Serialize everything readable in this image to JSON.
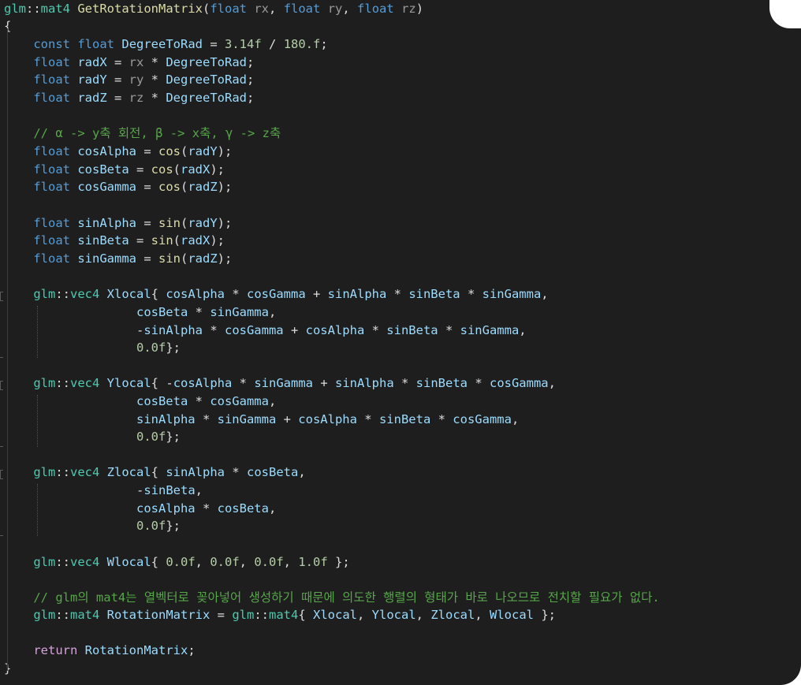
{
  "editor": {
    "language": "C++",
    "theme_colors": {
      "background": "#1e1e1e",
      "keyword": "#569cd6",
      "type_namespace": "#4ec9b0",
      "identifier": "#9cdcfe",
      "function": "#dcdcaa",
      "number": "#b5cea8",
      "comment": "#57a64a",
      "control_keyword": "#d8a0df"
    },
    "lines": [
      [
        [
          "glm",
          "ns"
        ],
        [
          "::",
          "punc"
        ],
        [
          "mat4",
          "ns"
        ],
        [
          " ",
          "punc"
        ],
        [
          "GetRotationMatrix",
          "fn"
        ],
        [
          "(",
          "punc"
        ],
        [
          "float",
          "kw"
        ],
        [
          " ",
          "punc"
        ],
        [
          "rx",
          "param"
        ],
        [
          ", ",
          "punc"
        ],
        [
          "float",
          "kw"
        ],
        [
          " ",
          "punc"
        ],
        [
          "ry",
          "param"
        ],
        [
          ", ",
          "punc"
        ],
        [
          "float",
          "kw"
        ],
        [
          " ",
          "punc"
        ],
        [
          "rz",
          "param"
        ],
        [
          ")",
          "punc"
        ]
      ],
      [
        [
          "{",
          "brace"
        ]
      ],
      [
        [
          "    ",
          "punc"
        ],
        [
          "const",
          "kw"
        ],
        [
          " ",
          "punc"
        ],
        [
          "float",
          "kw"
        ],
        [
          " ",
          "punc"
        ],
        [
          "DegreeToRad",
          "id"
        ],
        [
          " = ",
          "punc"
        ],
        [
          "3.14f",
          "num"
        ],
        [
          " / ",
          "punc"
        ],
        [
          "180.f",
          "num"
        ],
        [
          ";",
          "punc"
        ]
      ],
      [
        [
          "    ",
          "punc"
        ],
        [
          "float",
          "kw"
        ],
        [
          " ",
          "punc"
        ],
        [
          "radX",
          "id"
        ],
        [
          " = ",
          "punc"
        ],
        [
          "rx",
          "param"
        ],
        [
          " * ",
          "punc"
        ],
        [
          "DegreeToRad",
          "id"
        ],
        [
          ";",
          "punc"
        ]
      ],
      [
        [
          "    ",
          "punc"
        ],
        [
          "float",
          "kw"
        ],
        [
          " ",
          "punc"
        ],
        [
          "radY",
          "id"
        ],
        [
          " = ",
          "punc"
        ],
        [
          "ry",
          "param"
        ],
        [
          " * ",
          "punc"
        ],
        [
          "DegreeToRad",
          "id"
        ],
        [
          ";",
          "punc"
        ]
      ],
      [
        [
          "    ",
          "punc"
        ],
        [
          "float",
          "kw"
        ],
        [
          " ",
          "punc"
        ],
        [
          "radZ",
          "id"
        ],
        [
          " = ",
          "punc"
        ],
        [
          "rz",
          "param"
        ],
        [
          " * ",
          "punc"
        ],
        [
          "DegreeToRad",
          "id"
        ],
        [
          ";",
          "punc"
        ]
      ],
      [],
      [
        [
          "    ",
          "punc"
        ],
        [
          "// α -> y축 회전, β -> x축, γ -> z축",
          "cmt"
        ]
      ],
      [
        [
          "    ",
          "punc"
        ],
        [
          "float",
          "kw"
        ],
        [
          " ",
          "punc"
        ],
        [
          "cosAlpha",
          "id"
        ],
        [
          " = ",
          "punc"
        ],
        [
          "cos",
          "fn"
        ],
        [
          "(",
          "punc"
        ],
        [
          "radY",
          "id"
        ],
        [
          ");",
          "punc"
        ]
      ],
      [
        [
          "    ",
          "punc"
        ],
        [
          "float",
          "kw"
        ],
        [
          " ",
          "punc"
        ],
        [
          "cosBeta",
          "id"
        ],
        [
          " = ",
          "punc"
        ],
        [
          "cos",
          "fn"
        ],
        [
          "(",
          "punc"
        ],
        [
          "radX",
          "id"
        ],
        [
          ");",
          "punc"
        ]
      ],
      [
        [
          "    ",
          "punc"
        ],
        [
          "float",
          "kw"
        ],
        [
          " ",
          "punc"
        ],
        [
          "cosGamma",
          "id"
        ],
        [
          " = ",
          "punc"
        ],
        [
          "cos",
          "fn"
        ],
        [
          "(",
          "punc"
        ],
        [
          "radZ",
          "id"
        ],
        [
          ");",
          "punc"
        ]
      ],
      [],
      [
        [
          "    ",
          "punc"
        ],
        [
          "float",
          "kw"
        ],
        [
          " ",
          "punc"
        ],
        [
          "sinAlpha",
          "id"
        ],
        [
          " = ",
          "punc"
        ],
        [
          "sin",
          "fn"
        ],
        [
          "(",
          "punc"
        ],
        [
          "radY",
          "id"
        ],
        [
          ");",
          "punc"
        ]
      ],
      [
        [
          "    ",
          "punc"
        ],
        [
          "float",
          "kw"
        ],
        [
          " ",
          "punc"
        ],
        [
          "sinBeta",
          "id"
        ],
        [
          " = ",
          "punc"
        ],
        [
          "sin",
          "fn"
        ],
        [
          "(",
          "punc"
        ],
        [
          "radX",
          "id"
        ],
        [
          ");",
          "punc"
        ]
      ],
      [
        [
          "    ",
          "punc"
        ],
        [
          "float",
          "kw"
        ],
        [
          " ",
          "punc"
        ],
        [
          "sinGamma",
          "id"
        ],
        [
          " = ",
          "punc"
        ],
        [
          "sin",
          "fn"
        ],
        [
          "(",
          "punc"
        ],
        [
          "radZ",
          "id"
        ],
        [
          ");",
          "punc"
        ]
      ],
      [],
      [
        [
          "    ",
          "punc"
        ],
        [
          "glm",
          "ns"
        ],
        [
          "::",
          "punc"
        ],
        [
          "vec4",
          "ns"
        ],
        [
          " ",
          "punc"
        ],
        [
          "Xlocal",
          "id"
        ],
        [
          "{ ",
          "punc"
        ],
        [
          "cosAlpha",
          "id"
        ],
        [
          " * ",
          "punc"
        ],
        [
          "cosGamma",
          "id"
        ],
        [
          " + ",
          "punc"
        ],
        [
          "sinAlpha",
          "id"
        ],
        [
          " * ",
          "punc"
        ],
        [
          "sinBeta",
          "id"
        ],
        [
          " * ",
          "punc"
        ],
        [
          "sinGamma",
          "id"
        ],
        [
          ",",
          "punc"
        ]
      ],
      [
        [
          "                  ",
          "punc"
        ],
        [
          "cosBeta",
          "id"
        ],
        [
          " * ",
          "punc"
        ],
        [
          "sinGamma",
          "id"
        ],
        [
          ",",
          "punc"
        ]
      ],
      [
        [
          "                  ",
          "punc"
        ],
        [
          "-",
          "punc"
        ],
        [
          "sinAlpha",
          "id"
        ],
        [
          " * ",
          "punc"
        ],
        [
          "cosGamma",
          "id"
        ],
        [
          " + ",
          "punc"
        ],
        [
          "cosAlpha",
          "id"
        ],
        [
          " * ",
          "punc"
        ],
        [
          "sinBeta",
          "id"
        ],
        [
          " * ",
          "punc"
        ],
        [
          "sinGamma",
          "id"
        ],
        [
          ",",
          "punc"
        ]
      ],
      [
        [
          "                  ",
          "punc"
        ],
        [
          "0.0f",
          "num"
        ],
        [
          "};",
          "punc"
        ]
      ],
      [],
      [
        [
          "    ",
          "punc"
        ],
        [
          "glm",
          "ns"
        ],
        [
          "::",
          "punc"
        ],
        [
          "vec4",
          "ns"
        ],
        [
          " ",
          "punc"
        ],
        [
          "Ylocal",
          "id"
        ],
        [
          "{ ",
          "punc"
        ],
        [
          "-",
          "punc"
        ],
        [
          "cosAlpha",
          "id"
        ],
        [
          " * ",
          "punc"
        ],
        [
          "sinGamma",
          "id"
        ],
        [
          " + ",
          "punc"
        ],
        [
          "sinAlpha",
          "id"
        ],
        [
          " * ",
          "punc"
        ],
        [
          "sinBeta",
          "id"
        ],
        [
          " * ",
          "punc"
        ],
        [
          "cosGamma",
          "id"
        ],
        [
          ",",
          "punc"
        ]
      ],
      [
        [
          "                  ",
          "punc"
        ],
        [
          "cosBeta",
          "id"
        ],
        [
          " * ",
          "punc"
        ],
        [
          "cosGamma",
          "id"
        ],
        [
          ",",
          "punc"
        ]
      ],
      [
        [
          "                  ",
          "punc"
        ],
        [
          "sinAlpha",
          "id"
        ],
        [
          " * ",
          "punc"
        ],
        [
          "sinGamma",
          "id"
        ],
        [
          " + ",
          "punc"
        ],
        [
          "cosAlpha",
          "id"
        ],
        [
          " * ",
          "punc"
        ],
        [
          "sinBeta",
          "id"
        ],
        [
          " * ",
          "punc"
        ],
        [
          "cosGamma",
          "id"
        ],
        [
          ",",
          "punc"
        ]
      ],
      [
        [
          "                  ",
          "punc"
        ],
        [
          "0.0f",
          "num"
        ],
        [
          "};",
          "punc"
        ]
      ],
      [],
      [
        [
          "    ",
          "punc"
        ],
        [
          "glm",
          "ns"
        ],
        [
          "::",
          "punc"
        ],
        [
          "vec4",
          "ns"
        ],
        [
          " ",
          "punc"
        ],
        [
          "Zlocal",
          "id"
        ],
        [
          "{ ",
          "punc"
        ],
        [
          "sinAlpha",
          "id"
        ],
        [
          " * ",
          "punc"
        ],
        [
          "cosBeta",
          "id"
        ],
        [
          ",",
          "punc"
        ]
      ],
      [
        [
          "                  ",
          "punc"
        ],
        [
          "-",
          "punc"
        ],
        [
          "sinBeta",
          "id"
        ],
        [
          ",",
          "punc"
        ]
      ],
      [
        [
          "                  ",
          "punc"
        ],
        [
          "cosAlpha",
          "id"
        ],
        [
          " * ",
          "punc"
        ],
        [
          "cosBeta",
          "id"
        ],
        [
          ",",
          "punc"
        ]
      ],
      [
        [
          "                  ",
          "punc"
        ],
        [
          "0.0f",
          "num"
        ],
        [
          "};",
          "punc"
        ]
      ],
      [],
      [
        [
          "    ",
          "punc"
        ],
        [
          "glm",
          "ns"
        ],
        [
          "::",
          "punc"
        ],
        [
          "vec4",
          "ns"
        ],
        [
          " ",
          "punc"
        ],
        [
          "Wlocal",
          "id"
        ],
        [
          "{ ",
          "punc"
        ],
        [
          "0.0f",
          "num"
        ],
        [
          ", ",
          "punc"
        ],
        [
          "0.0f",
          "num"
        ],
        [
          ", ",
          "punc"
        ],
        [
          "0.0f",
          "num"
        ],
        [
          ", ",
          "punc"
        ],
        [
          "1.0f",
          "num"
        ],
        [
          " };",
          "punc"
        ]
      ],
      [],
      [
        [
          "    ",
          "punc"
        ],
        [
          "// glm의 mat4는 열벡터로 꽂아넣어 생성하기 때문에 의도한 행렬의 형태가 바로 나오므로 전치할 필요가 없다.",
          "cmt"
        ]
      ],
      [
        [
          "    ",
          "punc"
        ],
        [
          "glm",
          "ns"
        ],
        [
          "::",
          "punc"
        ],
        [
          "mat4",
          "ns"
        ],
        [
          " ",
          "punc"
        ],
        [
          "RotationMatrix",
          "id"
        ],
        [
          " = ",
          "punc"
        ],
        [
          "glm",
          "ns"
        ],
        [
          "::",
          "punc"
        ],
        [
          "mat4",
          "ns"
        ],
        [
          "{ ",
          "punc"
        ],
        [
          "Xlocal",
          "id"
        ],
        [
          ", ",
          "punc"
        ],
        [
          "Ylocal",
          "id"
        ],
        [
          ", ",
          "punc"
        ],
        [
          "Zlocal",
          "id"
        ],
        [
          ", ",
          "punc"
        ],
        [
          "Wlocal",
          "id"
        ],
        [
          " };",
          "punc"
        ]
      ],
      [],
      [
        [
          "    ",
          "punc"
        ],
        [
          "return",
          "ret"
        ],
        [
          " ",
          "punc"
        ],
        [
          "RotationMatrix",
          "id"
        ],
        [
          ";",
          "punc"
        ]
      ],
      [
        [
          "}",
          "brace"
        ]
      ]
    ]
  }
}
